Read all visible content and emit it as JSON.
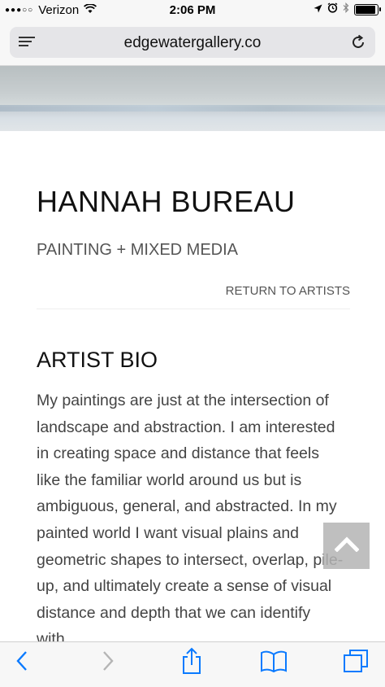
{
  "status_bar": {
    "signal": "●●●○○",
    "carrier": "Verizon",
    "time": "2:06 PM",
    "battery_level": 0.85
  },
  "address_bar": {
    "url": "edgewatergallery.co"
  },
  "page": {
    "artist_name": "HANNAH BUREAU",
    "medium": "PAINTING + MIXED MEDIA",
    "return_link": "RETURN TO ARTISTS",
    "section_heading": "ARTIST BIO",
    "bio": "My paintings are just at the intersection of landscape and abstraction. I am interested in creating space and distance that feels like the familiar world around us but is ambiguous, general, and abstracted. In my painted world I want visual plains and geometric shapes to intersect, overlap, pile-up, and ultimately create a sense of visual distance and depth that we can identify with."
  },
  "icons": {
    "wifi": "wifi-icon",
    "location": "location-arrow-icon",
    "alarm": "alarm-icon",
    "bluetooth": "bluetooth-icon",
    "battery": "battery-icon",
    "menu": "reader-menu-icon",
    "reload": "reload-icon",
    "back_to_top": "chevron-up-icon",
    "back": "back-chevron-icon",
    "forward": "forward-chevron-icon",
    "share": "share-icon",
    "bookmarks": "bookmarks-icon",
    "tabs": "tabs-icon"
  },
  "colors": {
    "ios_blue": "#0a7aff",
    "disabled_gray": "#b5b5b5"
  }
}
